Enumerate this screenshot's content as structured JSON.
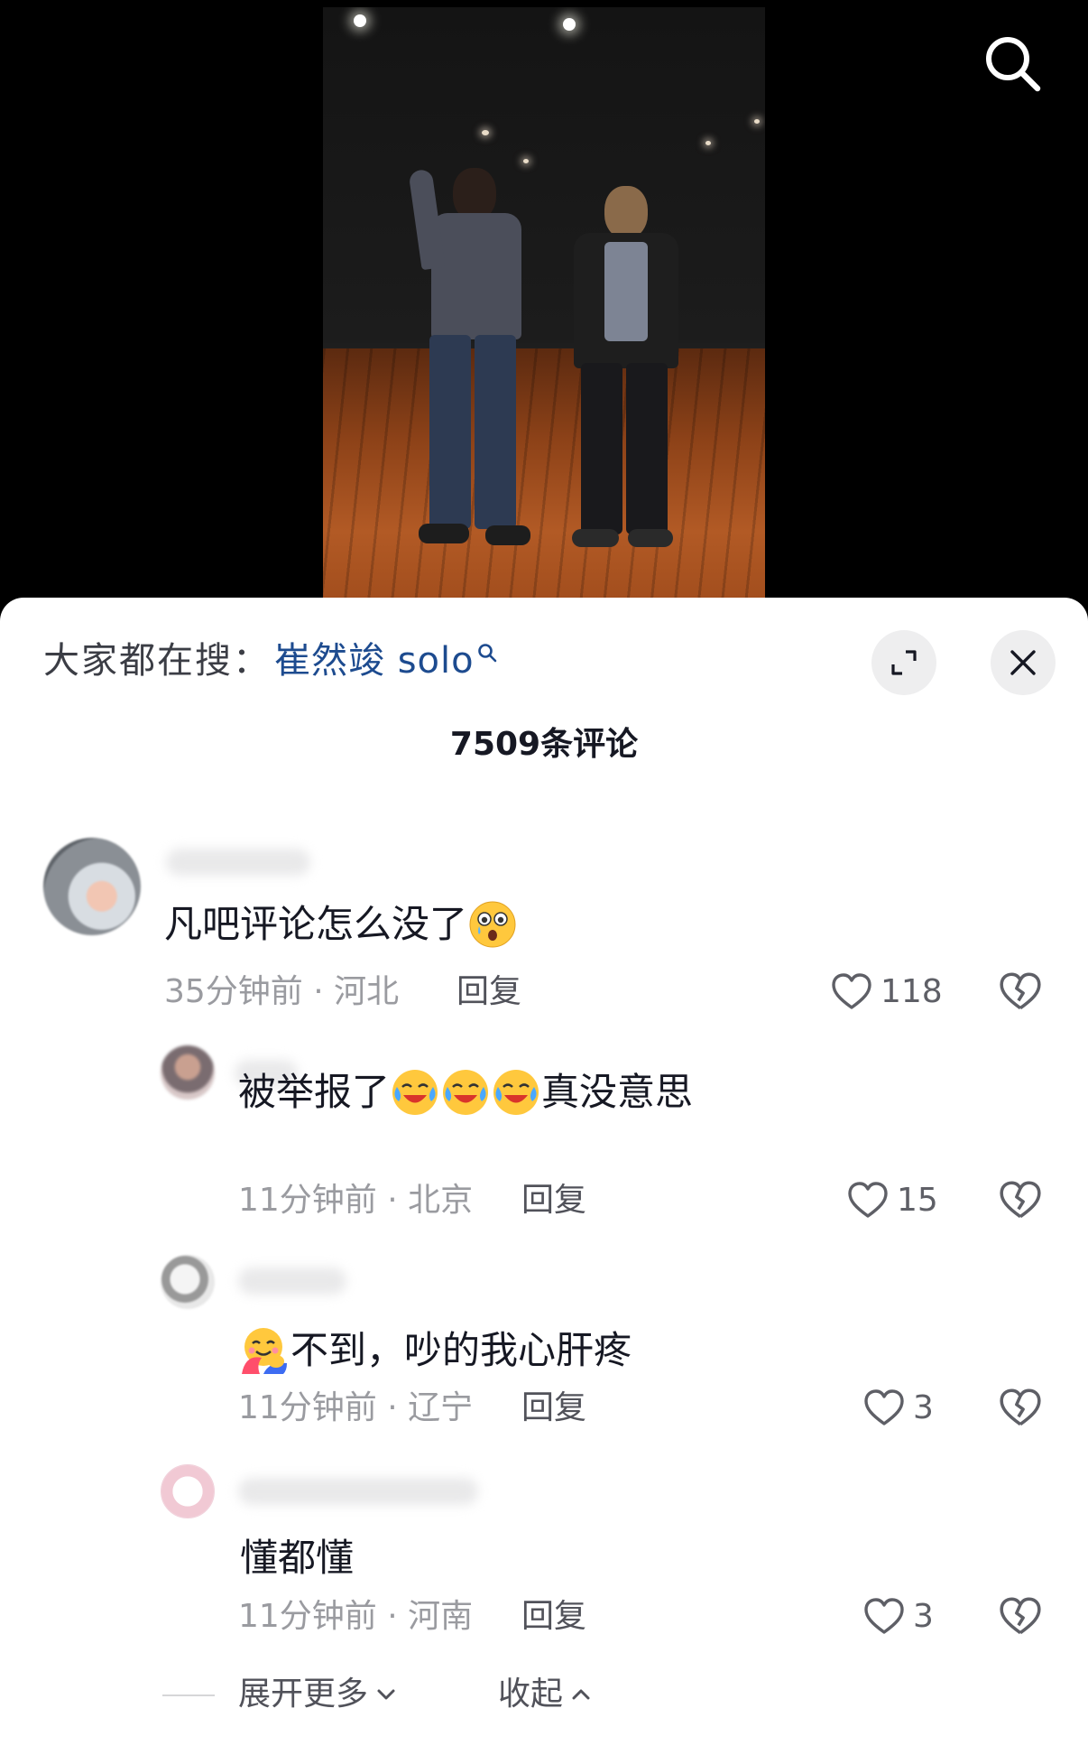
{
  "video": {
    "search_icon": "search-icon"
  },
  "sheet": {
    "trending_prefix": "大家都在搜：",
    "trending_term": "崔然竣 solo",
    "expand_icon": "expand-icon",
    "close_icon": "close-icon",
    "comment_count": "7509条评论"
  },
  "comments": [
    {
      "text": "凡吧评论怎么没了",
      "emoji": "surprised-crying-emoji",
      "time_location": "35分钟前 · 河北",
      "reply_label": "回复",
      "likes": "118"
    },
    {
      "text_before": "被举报了",
      "emoji": "laughing-crying-emoji",
      "emoji_count": 3,
      "text_after": "真没意思",
      "time_location": "11分钟前 · 北京",
      "reply_label": "回复",
      "likes": "15"
    },
    {
      "emoji": "hug-emoji",
      "text": "不到，吵的我心肝疼",
      "time_location": "11分钟前 · 辽宁",
      "reply_label": "回复",
      "likes": "3"
    },
    {
      "text": "懂都懂",
      "time_location": "11分钟前 · 河南",
      "reply_label": "回复",
      "likes": "3"
    }
  ],
  "footer": {
    "expand_more": "展开更多",
    "collapse": "收起"
  },
  "colors": {
    "accent_link": "#1d4b8f",
    "muted_text": "#9a9ba0",
    "primary_text": "#161823"
  }
}
